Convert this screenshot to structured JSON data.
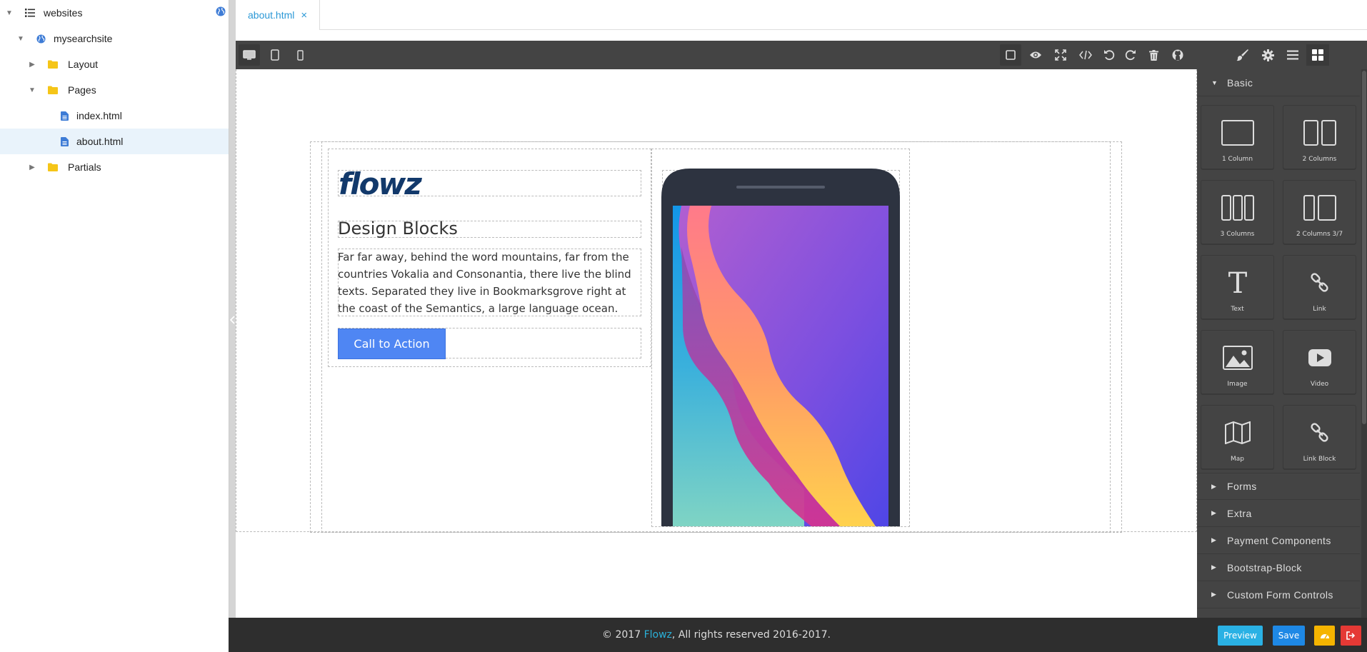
{
  "tree": {
    "root": {
      "label": "websites",
      "icon": "list-icon"
    },
    "site": {
      "label": "mysearchsite",
      "icon": "globe-icon"
    },
    "items": [
      {
        "label": "Layout",
        "icon": "folder-icon",
        "expanded": false
      },
      {
        "label": "Pages",
        "icon": "folder-icon",
        "expanded": true
      },
      {
        "label": "index.html",
        "icon": "file-icon"
      },
      {
        "label": "about.html",
        "icon": "file-icon",
        "selected": true
      },
      {
        "label": "Partials",
        "icon": "folder-icon",
        "expanded": false
      }
    ]
  },
  "tabs": [
    {
      "label": "about.html",
      "close": "×"
    }
  ],
  "canvas": {
    "logo_text": "flowz",
    "heading": "Design Blocks",
    "paragraph": "Far far away, behind the word mountains, far from the countries Vokalia and Consonantia, there live the blind texts. Separated they live in Bookmarksgrove right at the coast of the Semantics, a large language ocean.",
    "cta_label": "Call to Action"
  },
  "blocks_panel": {
    "categories_top": [
      {
        "label": "Basic",
        "expanded": true
      }
    ],
    "blocks": [
      {
        "label": "1 Column",
        "icon": "one-column-icon"
      },
      {
        "label": "2 Columns",
        "icon": "two-columns-icon"
      },
      {
        "label": "3 Columns",
        "icon": "three-columns-icon"
      },
      {
        "label": "2 Columns 3/7",
        "icon": "two-columns-37-icon"
      },
      {
        "label": "Text",
        "icon": "text-icon"
      },
      {
        "label": "Link",
        "icon": "link-icon"
      },
      {
        "label": "Image",
        "icon": "image-icon"
      },
      {
        "label": "Video",
        "icon": "video-icon"
      },
      {
        "label": "Map",
        "icon": "map-icon"
      },
      {
        "label": "Link Block",
        "icon": "link-block-icon"
      }
    ],
    "categories_bottom": [
      {
        "label": "Forms"
      },
      {
        "label": "Extra"
      },
      {
        "label": "Payment Components"
      },
      {
        "label": "Bootstrap-Block"
      },
      {
        "label": "Custom Form Controls"
      }
    ]
  },
  "footer": {
    "prefix": "© 2017 ",
    "brand": "Flowz",
    "suffix": ", All rights reserved 2016-2017.",
    "preview_label": "Preview",
    "save_label": "Save"
  },
  "colors": {
    "accent": "#2b98d6",
    "preview": "#2ab1e4",
    "save": "#1e88e5",
    "warning": "#f5b400",
    "danger": "#e53935",
    "cta": "#4f86f3",
    "toolbar": "#444444"
  }
}
